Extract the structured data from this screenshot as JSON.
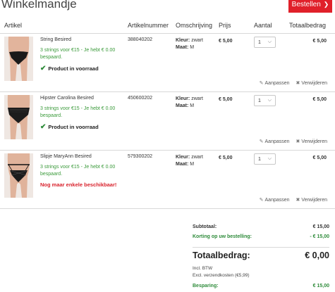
{
  "header": {
    "title": "Winkelmandje",
    "order_label": "Bestellen",
    "order_icon": "chevron-right-icon",
    "accent": "#e0202a"
  },
  "columns": [
    "Artikel",
    "Artikelnummer",
    "Omschrijving",
    "Prijs",
    "Aantal",
    "Totaalbedrag"
  ],
  "items": [
    {
      "name": "String Besired",
      "promo": "3 strings voor €15 - Je hebt € 0.00 bespaard.",
      "stock": "Product in voorraad",
      "stock_type": "ok",
      "artnr": "388040202",
      "kleur_label": "Kleur:",
      "kleur": "zwart",
      "maat_label": "Maat:",
      "maat": "M",
      "price": "€ 5,00",
      "qty": "1",
      "total": "€ 5,00",
      "edit_label": "Aanpassen",
      "remove_label": "Verwijderen"
    },
    {
      "name": "Hipster Carolina Besired",
      "promo": "3 strings voor €15 - Je hebt € 0.00 bespaard.",
      "stock": "Product in voorraad",
      "stock_type": "ok",
      "artnr": "450600202",
      "kleur_label": "Kleur:",
      "kleur": "zwart",
      "maat_label": "Maat:",
      "maat": "M",
      "price": "€ 5,00",
      "qty": "1",
      "total": "€ 5,00",
      "edit_label": "Aanpassen",
      "remove_label": "Verwijderen"
    },
    {
      "name": "Slipje MaryAnn Besired",
      "promo": "3 strings voor €15 - Je hebt € 0.00 bespaard.",
      "stock": "Nog maar enkele beschikbaar!",
      "stock_type": "warn",
      "artnr": "579300202",
      "kleur_label": "Kleur:",
      "kleur": "zwart",
      "maat_label": "Maat:",
      "maat": "M",
      "price": "€ 5,00",
      "qty": "1",
      "total": "€ 5,00",
      "edit_label": "Aanpassen",
      "remove_label": "Verwijderen"
    }
  ],
  "summary": {
    "subtotal_label": "Subtotaal:",
    "subtotal": "€ 15,00",
    "discount_label": "Korting op uw bestelling:",
    "discount": "- € 15,00",
    "total_label": "Totaalbedrag:",
    "total": "€ 0,00",
    "vat_note": "Incl. BTW",
    "shipping_note": "Excl. verzendkosten (€5,99)",
    "savings_label": "Besparing:",
    "savings": "€ 15,00"
  }
}
